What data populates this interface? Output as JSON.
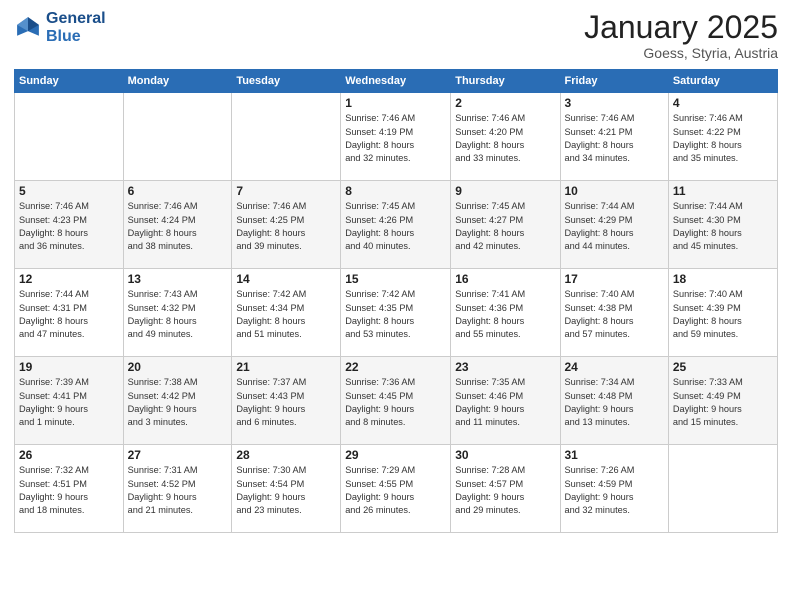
{
  "logo": {
    "line1": "General",
    "line2": "Blue"
  },
  "title": "January 2025",
  "subtitle": "Goess, Styria, Austria",
  "header": {
    "days": [
      "Sunday",
      "Monday",
      "Tuesday",
      "Wednesday",
      "Thursday",
      "Friday",
      "Saturday"
    ]
  },
  "weeks": [
    [
      {
        "num": "",
        "info": ""
      },
      {
        "num": "",
        "info": ""
      },
      {
        "num": "",
        "info": ""
      },
      {
        "num": "1",
        "info": "Sunrise: 7:46 AM\nSunset: 4:19 PM\nDaylight: 8 hours\nand 32 minutes."
      },
      {
        "num": "2",
        "info": "Sunrise: 7:46 AM\nSunset: 4:20 PM\nDaylight: 8 hours\nand 33 minutes."
      },
      {
        "num": "3",
        "info": "Sunrise: 7:46 AM\nSunset: 4:21 PM\nDaylight: 8 hours\nand 34 minutes."
      },
      {
        "num": "4",
        "info": "Sunrise: 7:46 AM\nSunset: 4:22 PM\nDaylight: 8 hours\nand 35 minutes."
      }
    ],
    [
      {
        "num": "5",
        "info": "Sunrise: 7:46 AM\nSunset: 4:23 PM\nDaylight: 8 hours\nand 36 minutes."
      },
      {
        "num": "6",
        "info": "Sunrise: 7:46 AM\nSunset: 4:24 PM\nDaylight: 8 hours\nand 38 minutes."
      },
      {
        "num": "7",
        "info": "Sunrise: 7:46 AM\nSunset: 4:25 PM\nDaylight: 8 hours\nand 39 minutes."
      },
      {
        "num": "8",
        "info": "Sunrise: 7:45 AM\nSunset: 4:26 PM\nDaylight: 8 hours\nand 40 minutes."
      },
      {
        "num": "9",
        "info": "Sunrise: 7:45 AM\nSunset: 4:27 PM\nDaylight: 8 hours\nand 42 minutes."
      },
      {
        "num": "10",
        "info": "Sunrise: 7:44 AM\nSunset: 4:29 PM\nDaylight: 8 hours\nand 44 minutes."
      },
      {
        "num": "11",
        "info": "Sunrise: 7:44 AM\nSunset: 4:30 PM\nDaylight: 8 hours\nand 45 minutes."
      }
    ],
    [
      {
        "num": "12",
        "info": "Sunrise: 7:44 AM\nSunset: 4:31 PM\nDaylight: 8 hours\nand 47 minutes."
      },
      {
        "num": "13",
        "info": "Sunrise: 7:43 AM\nSunset: 4:32 PM\nDaylight: 8 hours\nand 49 minutes."
      },
      {
        "num": "14",
        "info": "Sunrise: 7:42 AM\nSunset: 4:34 PM\nDaylight: 8 hours\nand 51 minutes."
      },
      {
        "num": "15",
        "info": "Sunrise: 7:42 AM\nSunset: 4:35 PM\nDaylight: 8 hours\nand 53 minutes."
      },
      {
        "num": "16",
        "info": "Sunrise: 7:41 AM\nSunset: 4:36 PM\nDaylight: 8 hours\nand 55 minutes."
      },
      {
        "num": "17",
        "info": "Sunrise: 7:40 AM\nSunset: 4:38 PM\nDaylight: 8 hours\nand 57 minutes."
      },
      {
        "num": "18",
        "info": "Sunrise: 7:40 AM\nSunset: 4:39 PM\nDaylight: 8 hours\nand 59 minutes."
      }
    ],
    [
      {
        "num": "19",
        "info": "Sunrise: 7:39 AM\nSunset: 4:41 PM\nDaylight: 9 hours\nand 1 minute."
      },
      {
        "num": "20",
        "info": "Sunrise: 7:38 AM\nSunset: 4:42 PM\nDaylight: 9 hours\nand 3 minutes."
      },
      {
        "num": "21",
        "info": "Sunrise: 7:37 AM\nSunset: 4:43 PM\nDaylight: 9 hours\nand 6 minutes."
      },
      {
        "num": "22",
        "info": "Sunrise: 7:36 AM\nSunset: 4:45 PM\nDaylight: 9 hours\nand 8 minutes."
      },
      {
        "num": "23",
        "info": "Sunrise: 7:35 AM\nSunset: 4:46 PM\nDaylight: 9 hours\nand 11 minutes."
      },
      {
        "num": "24",
        "info": "Sunrise: 7:34 AM\nSunset: 4:48 PM\nDaylight: 9 hours\nand 13 minutes."
      },
      {
        "num": "25",
        "info": "Sunrise: 7:33 AM\nSunset: 4:49 PM\nDaylight: 9 hours\nand 15 minutes."
      }
    ],
    [
      {
        "num": "26",
        "info": "Sunrise: 7:32 AM\nSunset: 4:51 PM\nDaylight: 9 hours\nand 18 minutes."
      },
      {
        "num": "27",
        "info": "Sunrise: 7:31 AM\nSunset: 4:52 PM\nDaylight: 9 hours\nand 21 minutes."
      },
      {
        "num": "28",
        "info": "Sunrise: 7:30 AM\nSunset: 4:54 PM\nDaylight: 9 hours\nand 23 minutes."
      },
      {
        "num": "29",
        "info": "Sunrise: 7:29 AM\nSunset: 4:55 PM\nDaylight: 9 hours\nand 26 minutes."
      },
      {
        "num": "30",
        "info": "Sunrise: 7:28 AM\nSunset: 4:57 PM\nDaylight: 9 hours\nand 29 minutes."
      },
      {
        "num": "31",
        "info": "Sunrise: 7:26 AM\nSunset: 4:59 PM\nDaylight: 9 hours\nand 32 minutes."
      },
      {
        "num": "",
        "info": ""
      }
    ]
  ]
}
